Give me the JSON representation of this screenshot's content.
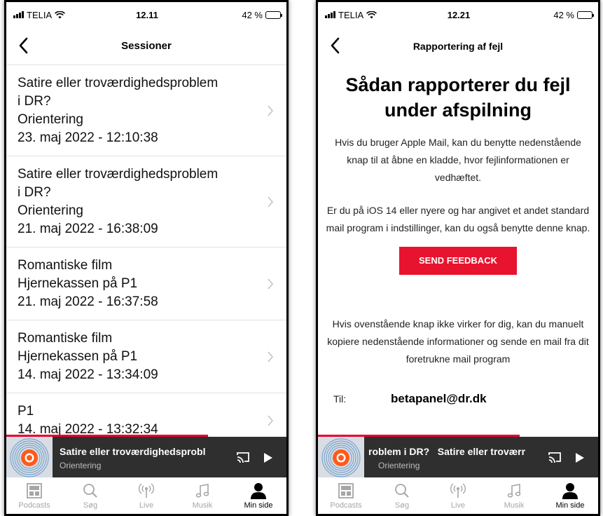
{
  "left": {
    "status": {
      "carrier": "TELIA",
      "time": "12.11",
      "battery": "42 %"
    },
    "nav": {
      "title": "Sessioner"
    },
    "sessions": [
      {
        "lines": [
          "Satire eller troværdighedsproblem",
          "i DR?",
          "Orientering",
          "23. maj 2022 - 12:10:38"
        ]
      },
      {
        "lines": [
          "Satire eller troværdighedsproblem",
          "i DR?",
          "Orientering",
          "21. maj 2022 - 16:38:09"
        ]
      },
      {
        "lines": [
          "Romantiske film",
          "Hjernekassen på P1",
          "21. maj 2022 - 16:37:58"
        ]
      },
      {
        "lines": [
          "Romantiske film",
          "Hjernekassen på P1",
          "14. maj 2022 - 13:34:09"
        ]
      },
      {
        "lines": [
          "P1",
          "14. maj 2022 - 13:32:34"
        ]
      }
    ],
    "player": {
      "title": "Satire eller troværdighedsprobl",
      "subtitle": "Orientering"
    }
  },
  "right": {
    "status": {
      "carrier": "TELIA",
      "time": "12.21",
      "battery": "42 %"
    },
    "nav": {
      "title": "Rapportering af fejl"
    },
    "heading": "Sådan rapporterer du fejl under afspilning",
    "para1": "Hvis du bruger Apple Mail, kan du benytte nedenstående knap til at åbne en kladde, hvor fejlinformationen er vedhæftet.",
    "para2": "Er du på iOS 14 eller nyere og har angivet et andet standard mail program i indstillinger, kan du også benytte denne knap.",
    "feedback_button": "SEND FEEDBACK",
    "para3": "Hvis ovenstående knap ikke virker for dig, kan du manuelt kopiere nedenstående informationer og sende en mail fra dit foretrukne mail program",
    "to_label": "Til:",
    "to_email": "betapanel@dr.dk",
    "player": {
      "title": "roblem i DR?   Satire eller troværr",
      "subtitle": "Orientering"
    }
  },
  "tabs": [
    {
      "label": "Podcasts",
      "icon": "podcasts-icon"
    },
    {
      "label": "Søg",
      "icon": "search-icon"
    },
    {
      "label": "Live",
      "icon": "live-radio-icon"
    },
    {
      "label": "Musik",
      "icon": "music-note-icon"
    },
    {
      "label": "Min side",
      "icon": "person-icon"
    }
  ],
  "player_progress_fraction": 0.72,
  "colors": {
    "accent": "#e8132e",
    "player_bg": "#2f2f2f",
    "divider": "#e2e2e2"
  }
}
